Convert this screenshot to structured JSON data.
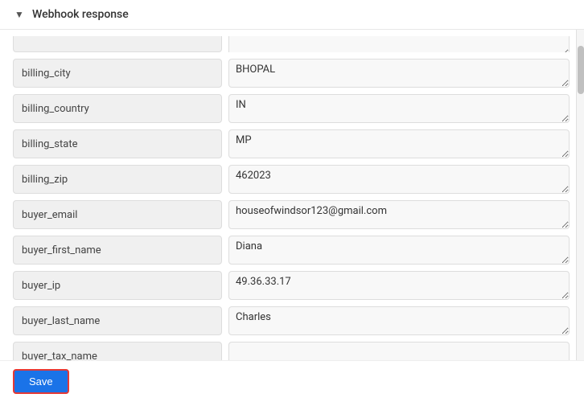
{
  "section": {
    "title": "Webhook response",
    "chevron": "▼"
  },
  "partial_row": {
    "key": "",
    "value": ""
  },
  "fields": [
    {
      "key": "billing_city",
      "value": "BHOPAL"
    },
    {
      "key": "billing_country",
      "value": "IN"
    },
    {
      "key": "billing_state",
      "value": "MP"
    },
    {
      "key": "billing_zip",
      "value": "462023"
    },
    {
      "key": "buyer_email",
      "value": "houseofwindsor123@gmail.com"
    },
    {
      "key": "buyer_first_name",
      "value": "Diana"
    },
    {
      "key": "buyer_ip",
      "value": "49.36.33.17"
    },
    {
      "key": "buyer_last_name",
      "value": "Charles"
    },
    {
      "key": "buyer_tax_name",
      "value": ""
    }
  ],
  "buttons": {
    "save": "Save"
  }
}
